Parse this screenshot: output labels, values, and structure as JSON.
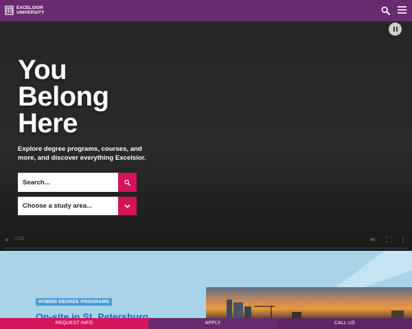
{
  "header": {
    "logo_line1": "EXCELSIOR",
    "logo_line2": "UNIVERSITY",
    "bg_color": "#6a2a6f",
    "search_icon": "search-icon",
    "menu_icon": "hamburger-menu-icon"
  },
  "hero": {
    "title_lines": [
      "You",
      "Belong",
      "Here"
    ],
    "description": "Explore degree programs, courses, and more, and discover everything Excelsior.",
    "search_placeholder": "Search...",
    "select_label": "Choose a study area...",
    "accent_color": "#d4145a",
    "video": {
      "time": "0:00",
      "pause_icon": "pause-icon"
    }
  },
  "promo": {
    "badge": "HYBRID DEGREE PROGRAMS",
    "heading": "On-site in St. Petersburg"
  },
  "bottom_bar": {
    "request_info": "REQUEST INFO",
    "apply": "APPLY",
    "call_us": "CALL US"
  }
}
